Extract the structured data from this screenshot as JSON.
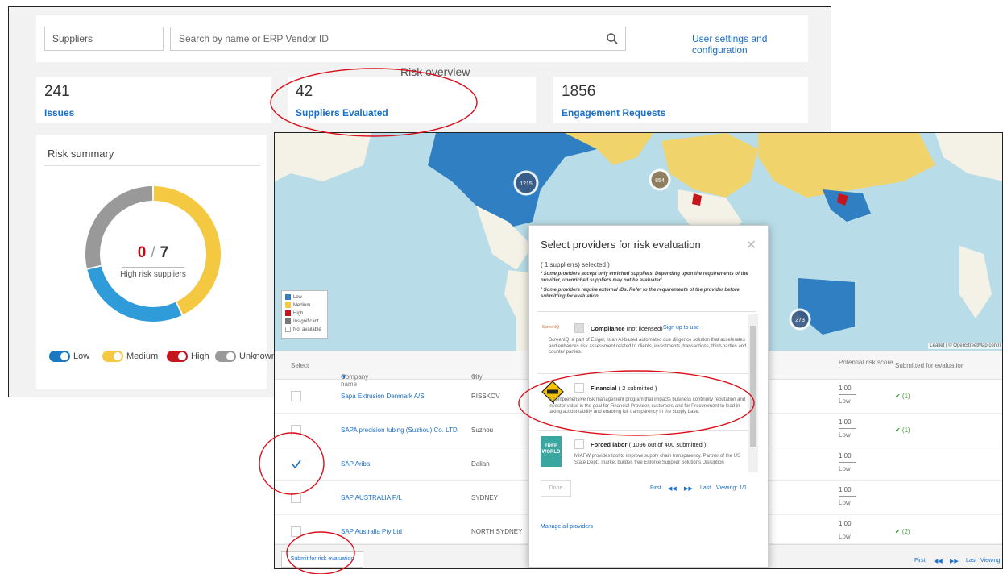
{
  "topbar": {
    "suppliers_select": "Suppliers",
    "search_placeholder": "Search by name or ERP Vendor ID",
    "user_settings": "User settings and configuration"
  },
  "risk_overview": {
    "title": "Risk overview",
    "stats": [
      {
        "value": "241",
        "label": "Issues"
      },
      {
        "value": "42",
        "label": "Suppliers Evaluated"
      },
      {
        "value": "1856",
        "label": "Engagement Requests"
      }
    ]
  },
  "risk_summary": {
    "title": "Risk summary",
    "high_risk_count": "0",
    "separator": "/",
    "total": "7",
    "caption": "High risk suppliers",
    "chart_data": {
      "type": "pie",
      "values": [
        3,
        2,
        2
      ],
      "colors": [
        "#f5c842",
        "#2f9bd9",
        "#999999"
      ],
      "note": "donut segments: Medium, Low, Unknown"
    },
    "toggles": [
      {
        "label": "Low",
        "color": "#1a78c2"
      },
      {
        "label": "Medium",
        "color": "#f5c842"
      },
      {
        "label": "High",
        "color": "#c4161c"
      },
      {
        "label": "Unknown",
        "color": "#999999"
      }
    ]
  },
  "map": {
    "clusters": [
      "1215",
      "854",
      "273"
    ],
    "legend": [
      {
        "label": "Low",
        "color": "#2f7fc2"
      },
      {
        "label": "Medium",
        "color": "#f5c842"
      },
      {
        "label": "High",
        "color": "#c4161c"
      },
      {
        "label": "Insignificant",
        "color": "#777777"
      },
      {
        "label": "Not available",
        "color": "#ffffff"
      }
    ],
    "attribution": "Leaflet | © OpenStreetMap contri"
  },
  "table": {
    "headers": {
      "select": "Select",
      "company": "Company name",
      "city": "City",
      "risk_score": "Potential risk score",
      "submitted": "Submitted for evaluation"
    },
    "rows": [
      {
        "company": "Sapa Extrusion Denmark A/S",
        "city": "RISSKOV",
        "score": "1.00",
        "level": "Low",
        "submitted": "✔ (1)",
        "checked": false
      },
      {
        "company": "SAPA precision tubing (Suzhou) Co. LTD",
        "city": "Suzhou",
        "score": "1.00",
        "level": "Low",
        "submitted": "✔ (1)",
        "checked": false
      },
      {
        "company": "SAP Ariba",
        "city": "Dalian",
        "score": "1.00",
        "level": "Low",
        "submitted": "",
        "checked": true
      },
      {
        "company": "SAP AUSTRALIA P/L",
        "city": "SYDNEY",
        "score": "1.00",
        "level": "Low",
        "submitted": "",
        "checked": false
      },
      {
        "company": "SAP Australia Pty Ltd",
        "city": "NORTH SYDNEY",
        "score": "1.00",
        "level": "Low",
        "submitted": "✔ (2)",
        "checked": false
      }
    ],
    "submit_button": "Submit for risk evaluation",
    "pager": {
      "first": "First",
      "prev": "◀◀",
      "next": "▶▶",
      "last": "Last",
      "viewing": "Viewing"
    }
  },
  "modal": {
    "title": "Select providers for risk evaluation",
    "selected": "( 1 supplier(s) selected )",
    "note1": "¹ Some providers accept only enriched suppliers. Depending upon the requirements of the provider, unenriched suppliers may not be evaluated.",
    "note2": "² Some providers require external IDs. Refer to the requirements of the provider before submitting for evaluation.",
    "providers": [
      {
        "logo_text": "ScreenIQ",
        "name": "Compliance",
        "status": "(not licensed)",
        "link": "Sign up to use",
        "desc": "ScreenIQ, a part of Exiger, is an AI-based automated due diligence solution that accelerates and enhances risk assessment related to clients, investments, transactions, third-parties and counter parties."
      },
      {
        "name": "Financial",
        "status": "( 2 submitted )",
        "desc": "A comprehensive risk management program that impacts business continuity reputation and investor value is the goal for Financial Provider, customers and for Procurement to lead in taking accountability and enabling full transparency in the supply base."
      },
      {
        "logo_text": "FREE WORLD",
        "name": "Forced labor",
        "status": "( 1096 out of 400 submitted )",
        "desc": "MIAFW provides tool to improve supply chain transparency. Partner of the US State Dept., market builder, free Enforce Supplier Solutions Disruption"
      }
    ],
    "done": "Done",
    "pager": {
      "first": "First",
      "prev": "◀◀",
      "next": "▶▶",
      "last": "Last",
      "viewing": "Viewing: 1/1"
    },
    "manage": "Manage all providers",
    "close": "✕"
  }
}
